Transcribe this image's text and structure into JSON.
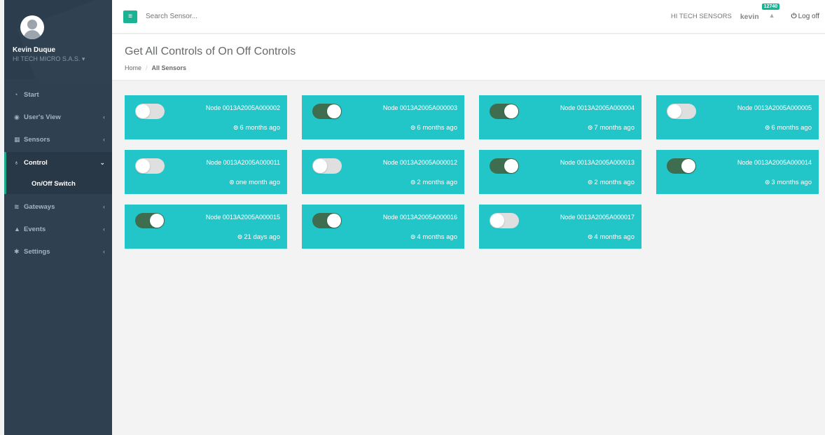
{
  "user": {
    "name": "Kevin Duque",
    "company": "HI TECH MICRO S.A.S. ▾"
  },
  "topbar": {
    "search_placeholder": "Search Sensor...",
    "brand": "HI TECH SENSORS",
    "username": "kevin",
    "notification_count": "12740",
    "logoff_label": "Log off"
  },
  "nav": {
    "start": "Start",
    "users_view": "User's View",
    "sensors": "Sensors",
    "control": "Control",
    "onoff_switch": "On/Off Switch",
    "gateways": "Gateways",
    "events": "Events",
    "settings": "Settings"
  },
  "page": {
    "title": "Get All Controls of On Off Controls",
    "breadcrumb_home": "Home",
    "breadcrumb_sep": "/",
    "breadcrumb_current": "All Sensors"
  },
  "controls": [
    {
      "node": "Node 0013A2005A000002",
      "time": "6 months ago",
      "on": false
    },
    {
      "node": "Node 0013A2005A000003",
      "time": "6 months ago",
      "on": true
    },
    {
      "node": "Node 0013A2005A000004",
      "time": "7 months ago",
      "on": true
    },
    {
      "node": "Node 0013A2005A000005",
      "time": "6 months ago",
      "on": false
    },
    {
      "node": "Node 0013A2005A000011",
      "time": "one month ago",
      "on": false
    },
    {
      "node": "Node 0013A2005A000012",
      "time": "2 months ago",
      "on": false
    },
    {
      "node": "Node 0013A2005A000013",
      "time": "2 months ago",
      "on": true
    },
    {
      "node": "Node 0013A2005A000014",
      "time": "3 months ago",
      "on": true
    },
    {
      "node": "Node 0013A2005A000015",
      "time": "21 days ago",
      "on": true
    },
    {
      "node": "Node 0013A2005A000016",
      "time": "4 months ago",
      "on": true
    },
    {
      "node": "Node 0013A2005A000017",
      "time": "4 months ago",
      "on": false
    }
  ]
}
